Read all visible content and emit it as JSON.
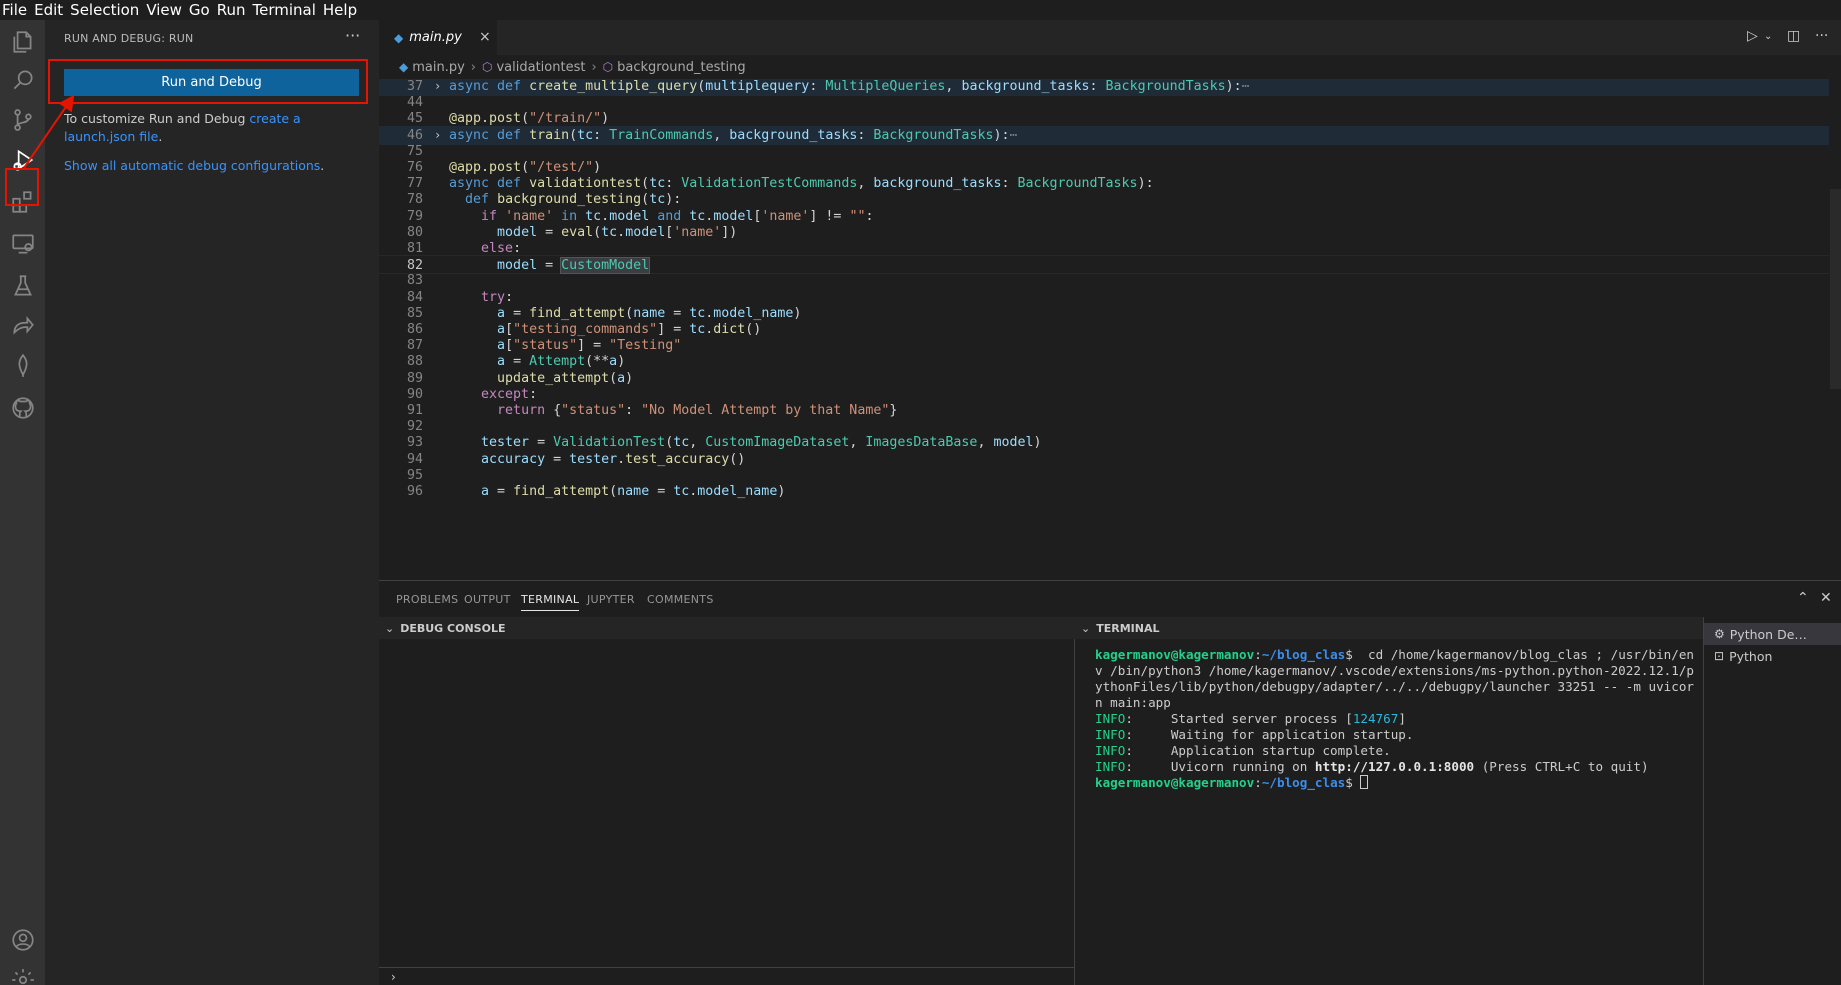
{
  "menubar": [
    "File",
    "Edit",
    "Selection",
    "View",
    "Go",
    "Run",
    "Terminal",
    "Help"
  ],
  "activity_bar": {
    "icons": [
      "explorer-icon",
      "search-icon",
      "source-control-icon",
      "run-debug-icon",
      "extensions-icon",
      "remote-explorer-icon",
      "testing-icon",
      "live-share-icon",
      "mongodb-icon",
      "github-icon",
      "account-icon",
      "settings-gear-icon"
    ],
    "active": "run-debug-icon",
    "highlight_color": "#e51400"
  },
  "sidebar": {
    "title": "RUN AND DEBUG: RUN",
    "more": "···",
    "run_button_label": "Run and Debug",
    "customize_prefix": "To customize Run and Debug ",
    "customize_link": "create a launch.json file",
    "customize_suffix": ".",
    "show_all_link": "Show all automatic debug configurations",
    "show_all_suffix": "."
  },
  "editor": {
    "tab_label": "main.py",
    "tab_close": "×",
    "breadcrumb": [
      "main.py",
      "validationtest",
      "background_testing"
    ],
    "lines": [
      {
        "n": "37",
        "fold": "›",
        "hl": true,
        "html": "<span class='t-kw'>async</span> <span class='t-kw'>def</span> <span class='t-fn'>create_multiple_query</span>(<span class='t-var'>multiplequery</span>: <span class='t-cls'>MultipleQueries</span>, <span class='t-var'>background_tasks</span>: <span class='t-cls'>BackgroundTasks</span>):<span class='t-ell'>⋯</span>"
      },
      {
        "n": "44",
        "html": ""
      },
      {
        "n": "45",
        "html": "<span class='t-dec'>@app.post</span>(<span class='t-str'>\"/train/\"</span>)"
      },
      {
        "n": "46",
        "fold": "›",
        "hl": true,
        "html": "<span class='t-kw'>async</span> <span class='t-kw'>def</span> <span class='t-fn'>train</span>(<span class='t-var'>tc</span>: <span class='t-cls'>TrainCommands</span>, <span class='t-var'>background_tasks</span>: <span class='t-cls'>BackgroundTasks</span>):<span class='t-ell'>⋯</span>"
      },
      {
        "n": "75",
        "html": ""
      },
      {
        "n": "76",
        "html": "<span class='t-dec'>@app.post</span>(<span class='t-str'>\"/test/\"</span>)"
      },
      {
        "n": "77",
        "html": "<span class='t-kw'>async</span> <span class='t-kw'>def</span> <span class='t-fn'>validationtest</span>(<span class='t-var'>tc</span>: <span class='t-cls'>ValidationTestCommands</span>, <span class='t-var'>background_tasks</span>: <span class='t-cls'>BackgroundTasks</span>):"
      },
      {
        "n": "78",
        "html": "  <span class='t-kw'>def</span> <span class='t-fn'>background_testing</span>(<span class='t-var'>tc</span>):"
      },
      {
        "n": "79",
        "html": "    <span class='t-ctrl'>if</span> <span class='t-str'>'name'</span> <span class='t-kw'>in</span> <span class='t-var'>tc</span>.<span class='t-var'>model</span> <span class='t-kw'>and</span> <span class='t-var'>tc</span>.<span class='t-var'>model</span>[<span class='t-str'>'name'</span>] != <span class='t-str'>\"\"</span>:"
      },
      {
        "n": "80",
        "html": "      <span class='t-var'>model</span> = <span class='t-fn'>eval</span>(<span class='t-var'>tc</span>.<span class='t-var'>model</span>[<span class='t-str'>'name'</span>])"
      },
      {
        "n": "81",
        "html": "    <span class='t-ctrl'>else</span>:"
      },
      {
        "n": "82",
        "current": true,
        "html": "      <span class='t-var'>model</span> = <span class='t-cls sel-word'>CustomModel</span>"
      },
      {
        "n": "83",
        "html": ""
      },
      {
        "n": "84",
        "html": "    <span class='t-ctrl'>try</span>:"
      },
      {
        "n": "85",
        "html": "      <span class='t-var'>a</span> = <span class='t-fn'>find_attempt</span>(<span class='t-var'>name</span> = <span class='t-var'>tc</span>.<span class='t-var'>model_name</span>)"
      },
      {
        "n": "86",
        "html": "      <span class='t-var'>a</span>[<span class='t-str'>\"testing_commands\"</span>] = <span class='t-var'>tc</span>.<span class='t-fn'>dict</span>()"
      },
      {
        "n": "87",
        "html": "      <span class='t-var'>a</span>[<span class='t-str'>\"status\"</span>] = <span class='t-str'>\"Testing\"</span>"
      },
      {
        "n": "88",
        "html": "      <span class='t-var'>a</span> = <span class='t-cls'>Attempt</span>(**<span class='t-var'>a</span>)"
      },
      {
        "n": "89",
        "html": "      <span class='t-fn'>update_attempt</span>(<span class='t-var'>a</span>)"
      },
      {
        "n": "90",
        "html": "    <span class='t-ctrl'>except</span>:"
      },
      {
        "n": "91",
        "html": "      <span class='t-ctrl'>return</span> {<span class='t-str'>\"status\"</span>: <span class='t-str'>\"No Model Attempt by that Name\"</span>}"
      },
      {
        "n": "92",
        "html": ""
      },
      {
        "n": "93",
        "html": "    <span class='t-var'>tester</span> = <span class='t-cls'>ValidationTest</span>(<span class='t-var'>tc</span>, <span class='t-cls'>CustomImageDataset</span>, <span class='t-cls'>ImagesDataBase</span>, <span class='t-var'>model</span>)"
      },
      {
        "n": "94",
        "html": "    <span class='t-var'>accuracy</span> = <span class='t-var'>tester</span>.<span class='t-fn'>test_accuracy</span>()"
      },
      {
        "n": "95",
        "html": ""
      },
      {
        "n": "96",
        "html": "    <span class='t-var'>a</span> = <span class='t-fn'>find_attempt</span>(<span class='t-var'>name</span> = <span class='t-var'>tc</span>.<span class='t-var'>model_name</span>)"
      }
    ]
  },
  "panel": {
    "tabs": [
      "PROBLEMS",
      "OUTPUT",
      "TERMINAL",
      "JUPYTER",
      "COMMENTS"
    ],
    "active_tab": "TERMINAL",
    "debug_console_title": "DEBUG CONSOLE",
    "debug_prompt": "›",
    "terminal_title": "TERMINAL",
    "terminal_lines": [
      "<span class='tm-user'>kagermanov@kagermanov</span>:<span class='tm-path'>~/blog_clas</span>$  cd /home/kagermanov/blog_clas ; /usr/bin/env /bin/python3 /home/kagermanov/.vscode/extensions/ms-python.python-2022.12.1/pythonFiles/lib/python/debugpy/adapter/../../debugpy/launcher 33251 -- -m uvicorn main:app",
      "<span class='tm-info'>INFO</span>:     Started server process [<span class='tm-num'>124767</span>]",
      "<span class='tm-info'>INFO</span>:     Waiting for application startup.",
      "<span class='tm-info'>INFO</span>:     Application startup complete.",
      "<span class='tm-info'>INFO</span>:     Uvicorn running on <span class='tm-bold'>http://127.0.0.1:8000</span> (Press CTRL+C to quit)",
      "<span class='tm-user'>kagermanov@kagermanov</span>:<span class='tm-path'>~/blog_clas</span>$ <span class='cursor'></span>"
    ],
    "terminal_list": [
      {
        "icon": "debug-icon",
        "label": "Python De…",
        "active": true
      },
      {
        "icon": "terminal-icon",
        "label": "Python",
        "active": false
      }
    ]
  }
}
